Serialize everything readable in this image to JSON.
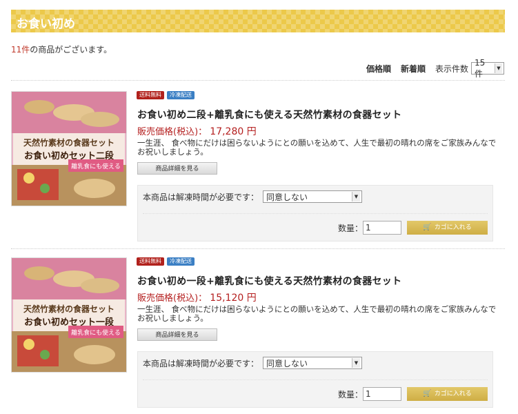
{
  "category": {
    "title": "お食い初め"
  },
  "results": {
    "count": "11件",
    "suffix": "の商品がございます。"
  },
  "sort": {
    "price_label": "価格順",
    "new_label": "新着順",
    "per_page_label": "表示件数",
    "per_page_value": "15件"
  },
  "products": [
    {
      "badges": [
        "送料無料",
        "冷凍配送"
      ],
      "title": "お食い初め二段+離乳食にも使える天然竹素材の食器セット",
      "price_label": "販売価格(税込)：",
      "price": "17,280 円",
      "description": "一生涯、 食べ物にだけは困らないようにとの願いを込めて、人生で最初の晴れの席をご家族みんなでお祝いしましょう。",
      "detail_button": "商品詳細を見る",
      "thaw_label": "本商品は解凍時間が必要です：",
      "thaw_option": "同意しない",
      "qty_label": "数量：",
      "qty_value": "1",
      "cart_button": "カゴに入れる",
      "image_text": {
        "line1": "天然竹素材の食器セット",
        "line2": "お食い初めセット二段",
        "line3": "離乳食にも使える"
      }
    },
    {
      "badges": [
        "送料無料",
        "冷凍配送"
      ],
      "title": "お食い初め一段+離乳食にも使える天然竹素材の食器セット",
      "price_label": "販売価格(税込)：",
      "price": "15,120 円",
      "description": "一生涯、 食べ物にだけは困らないようにとの願いを込めて、人生で最初の晴れの席をご家族みんなでお祝いしましょう。",
      "detail_button": "商品詳細を見る",
      "thaw_label": "本商品は解凍時間が必要です：",
      "thaw_option": "同意しない",
      "qty_label": "数量：",
      "qty_value": "1",
      "cart_button": "カゴに入れる",
      "image_text": {
        "line1": "天然竹素材の食器セット",
        "line2": "お食い初めセット一段",
        "line3": "離乳食にも使える"
      }
    }
  ],
  "colors": {
    "header_gold": "#ecc94a",
    "price_red": "#b41e1e",
    "badge_red": "#b1211c",
    "badge_blue": "#3b7fc4",
    "cart_gold": "#d4b44f"
  },
  "icons": {
    "cart": "cart-icon",
    "select_arrow": "chevron-down-icon"
  }
}
